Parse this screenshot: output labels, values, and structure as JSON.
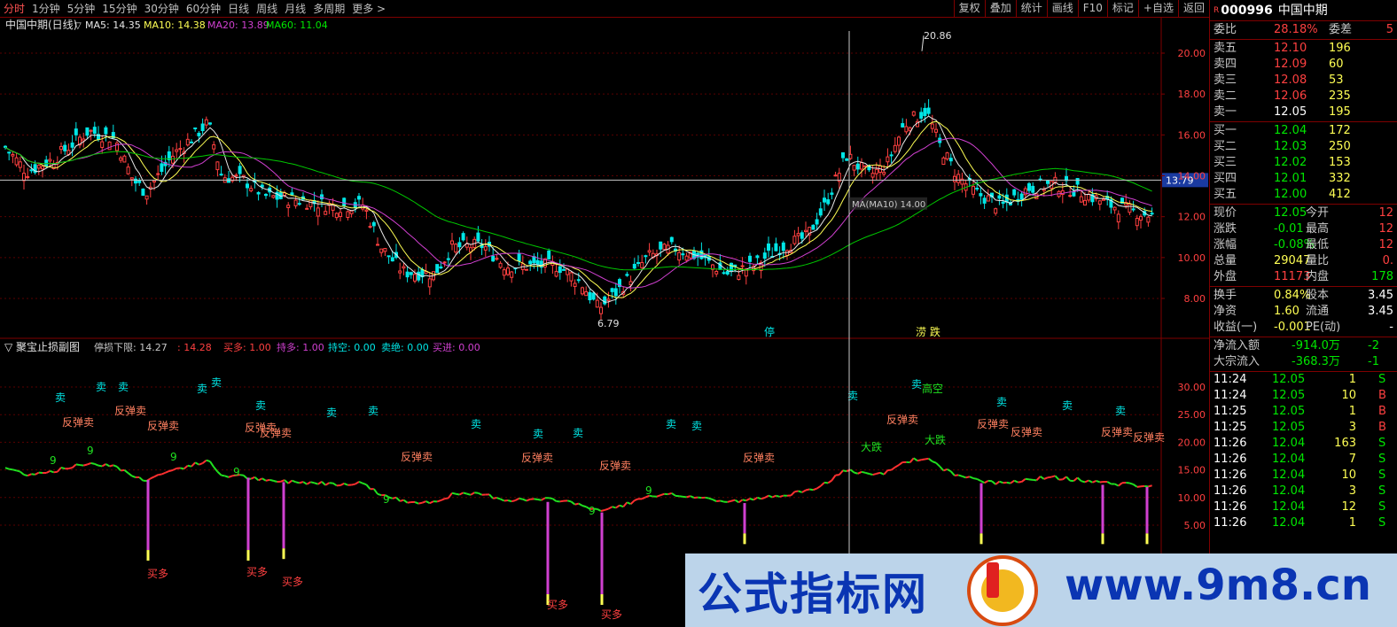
{
  "toolbar": {
    "timeframes": [
      "分时",
      "1分钟",
      "5分钟",
      "15分钟",
      "30分钟",
      "60分钟",
      "日线",
      "周线",
      "月线",
      "多周期",
      "更多 >"
    ],
    "active_timeframe": "分时",
    "right_buttons": [
      "复权",
      "叠加",
      "统计",
      "画线",
      "F10",
      "标记",
      "+自选",
      "返回"
    ]
  },
  "main_chart": {
    "title": "中国中期(日线)",
    "ma_legend": [
      {
        "label": "MA5: 14.35",
        "color": "#e8e8e8"
      },
      {
        "label": "MA10: 14.38",
        "color": "#ffff54"
      },
      {
        "label": "MA20: 13.89",
        "color": "#d040d0"
      },
      {
        "label": "MA60: 11.04",
        "color": "#00e600"
      }
    ],
    "y_ticks": [
      "20.00",
      "18.00",
      "16.00",
      "14.00",
      "12.00",
      "10.00",
      "8.00"
    ],
    "high_label": "20.86",
    "low_label": "6.79",
    "cursor_price": "13.79",
    "crosshair_tip": "MA(MA10) 14.00",
    "event_marks": [
      "停",
      "涝 跌"
    ]
  },
  "sub_chart": {
    "title": "聚宝止损副图",
    "legend": [
      {
        "label": "停损下限: 14.27",
        "color": "#c8c8c8"
      },
      {
        "label": ": 14.28",
        "color": "#ff4040"
      },
      {
        "label": "买多: 1.00",
        "color": "#ff4040"
      },
      {
        "label": "持多: 1.00",
        "color": "#d040d0"
      },
      {
        "label": "持空: 0.00",
        "color": "#00e6e6"
      },
      {
        "label": "卖绝: 0.00",
        "color": "#00e6e6"
      },
      {
        "label": "买进: 0.00",
        "color": "#d040d0"
      }
    ],
    "y_ticks": [
      "30.00",
      "25.00",
      "20.00",
      "15.00",
      "10.00",
      "5.00"
    ],
    "labels": {
      "sell": "卖",
      "rebound_sell": "反弹卖",
      "buy_long": "买多",
      "plunge": "大跌",
      "high_short": "高空",
      "nine": "9"
    }
  },
  "quote": {
    "badge": "R",
    "code": "000996",
    "name": "中国中期",
    "ratio": {
      "l1": "委比",
      "v1": "28.18%",
      "l2": "委差",
      "v2": "5"
    },
    "asks": [
      {
        "label": "卖五",
        "price": "12.10",
        "vol": "196"
      },
      {
        "label": "卖四",
        "price": "12.09",
        "vol": "60"
      },
      {
        "label": "卖三",
        "price": "12.08",
        "vol": "53"
      },
      {
        "label": "卖二",
        "price": "12.06",
        "vol": "235"
      },
      {
        "label": "卖一",
        "price": "12.05",
        "vol": "195"
      }
    ],
    "bids": [
      {
        "label": "买一",
        "price": "12.04",
        "vol": "172"
      },
      {
        "label": "买二",
        "price": "12.03",
        "vol": "250"
      },
      {
        "label": "买三",
        "price": "12.02",
        "vol": "153"
      },
      {
        "label": "买四",
        "price": "12.01",
        "vol": "332"
      },
      {
        "label": "买五",
        "price": "12.00",
        "vol": "412"
      }
    ],
    "stats": [
      {
        "l1": "现价",
        "v1": "12.05",
        "l2": "今开",
        "v2": "12"
      },
      {
        "l1": "涨跌",
        "v1": "-0.01",
        "l2": "最高",
        "v2": "12"
      },
      {
        "l1": "涨幅",
        "v1": "-0.08%",
        "l2": "最低",
        "v2": "12"
      },
      {
        "l1": "总量",
        "v1": "29047",
        "l2": "量比",
        "v2": "0."
      },
      {
        "l1": "外盘",
        "v1": "11173",
        "l2": "内盘",
        "v2": "178"
      }
    ],
    "finance": [
      {
        "l1": "换手",
        "v1": "0.84%",
        "l2": "股本",
        "v2": "3.45"
      },
      {
        "l1": "净资",
        "v1": "1.60",
        "l2": "流通",
        "v2": "3.45"
      },
      {
        "l1": "收益(一)",
        "v1": "-0.001",
        "l2": "PE(动)",
        "v2": "-"
      }
    ],
    "flows": [
      {
        "label": "净流入额",
        "value": "-914.0万",
        "extra": "-2"
      },
      {
        "label": "大宗流入",
        "value": "-368.3万",
        "extra": "-1"
      }
    ],
    "ticks": [
      {
        "time": "11:24",
        "price": "12.05",
        "vol": "1",
        "side": "S"
      },
      {
        "time": "11:24",
        "price": "12.05",
        "vol": "10",
        "side": "B"
      },
      {
        "time": "11:25",
        "price": "12.05",
        "vol": "1",
        "side": "B"
      },
      {
        "time": "11:25",
        "price": "12.05",
        "vol": "3",
        "side": "B"
      },
      {
        "time": "11:26",
        "price": "12.04",
        "vol": "163",
        "side": "S"
      },
      {
        "time": "11:26",
        "price": "12.04",
        "vol": "7",
        "side": "S"
      },
      {
        "time": "11:26",
        "price": "12.04",
        "vol": "10",
        "side": "S"
      },
      {
        "time": "11:26",
        "price": "12.04",
        "vol": "3",
        "side": "S"
      },
      {
        "time": "11:26",
        "price": "12.04",
        "vol": "12",
        "side": "S"
      },
      {
        "time": "11:26",
        "price": "12.04",
        "vol": "1",
        "side": "S"
      }
    ]
  },
  "watermark": {
    "cn": "公式指标网",
    "url": "www.9m8.cn"
  }
}
